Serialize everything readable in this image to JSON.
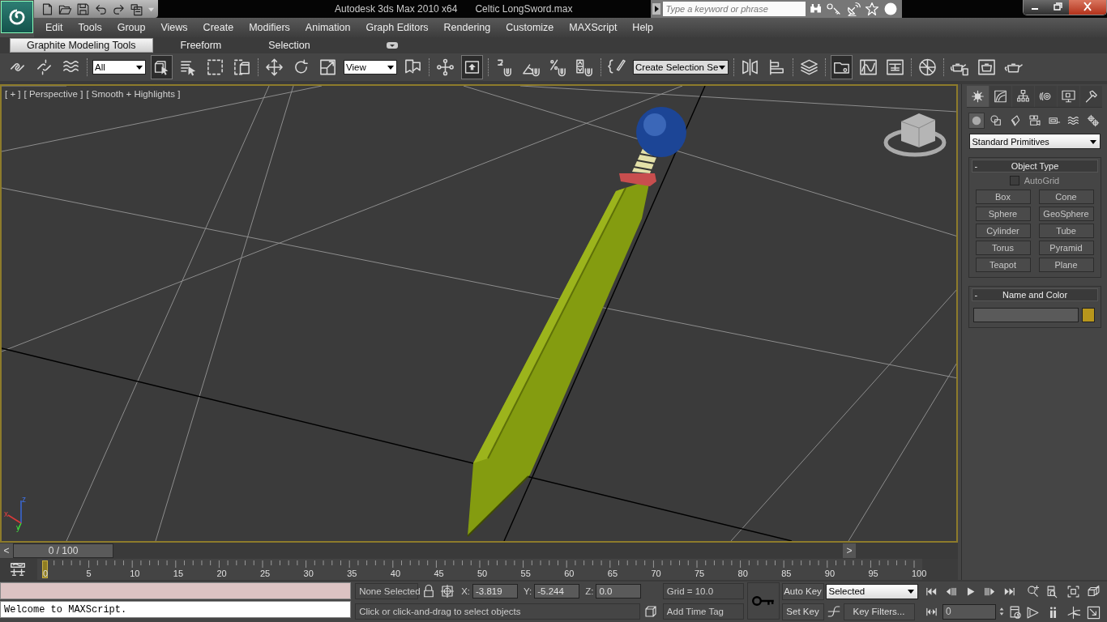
{
  "title_bar": {
    "app": "Autodesk 3ds Max  2010 x64",
    "file": "Celtic LongSword.max"
  },
  "search": {
    "placeholder": "Type a keyword or phrase"
  },
  "menu": [
    "Edit",
    "Tools",
    "Group",
    "Views",
    "Create",
    "Modifiers",
    "Animation",
    "Graph Editors",
    "Rendering",
    "Customize",
    "MAXScript",
    "Help"
  ],
  "ribbon_tabs": [
    {
      "label": "Graphite Modeling Tools",
      "selected": true
    },
    {
      "label": "Freeform",
      "selected": false
    },
    {
      "label": "Selection",
      "selected": false
    }
  ],
  "toolbar": [
    {
      "kind": "tool",
      "selected": false
    },
    {
      "kind": "tool",
      "selected": false
    },
    {
      "kind": "tool",
      "selected": false
    },
    {
      "kind": "separator"
    },
    {
      "kind": "dropdown",
      "value": "All"
    },
    {
      "kind": "tool",
      "selected": true
    },
    {
      "kind": "tool",
      "selected": false
    },
    {
      "kind": "tool",
      "selected": false
    },
    {
      "kind": "tool",
      "selected": false
    },
    {
      "kind": "separator"
    },
    {
      "kind": "tool",
      "selected": false
    },
    {
      "kind": "tool",
      "selected": false
    },
    {
      "kind": "tool",
      "selected": false
    },
    {
      "kind": "dropdown",
      "value": "View"
    },
    {
      "kind": "tool",
      "selected": false
    },
    {
      "kind": "separator"
    },
    {
      "kind": "tool",
      "selected": false
    },
    {
      "kind": "tool",
      "selected": true
    },
    {
      "kind": "separator"
    },
    {
      "kind": "tool",
      "selected": false
    },
    {
      "kind": "tool",
      "selected": false
    },
    {
      "kind": "tool",
      "selected": false
    },
    {
      "kind": "tool",
      "selected": false
    },
    {
      "kind": "separator"
    },
    {
      "kind": "tool",
      "selected": false
    },
    {
      "kind": "dropdown",
      "value": "Create Selection Se"
    },
    {
      "kind": "separator"
    },
    {
      "kind": "tool",
      "selected": false
    },
    {
      "kind": "tool",
      "selected": false
    },
    {
      "kind": "separator"
    },
    {
      "kind": "tool",
      "selected": false
    },
    {
      "kind": "separator"
    },
    {
      "kind": "tool",
      "selected": true
    },
    {
      "kind": "tool",
      "selected": false
    },
    {
      "kind": "tool",
      "selected": false
    },
    {
      "kind": "separator"
    },
    {
      "kind": "tool",
      "selected": false
    },
    {
      "kind": "separator"
    },
    {
      "kind": "tool",
      "selected": false
    },
    {
      "kind": "tool",
      "selected": false
    },
    {
      "kind": "tool",
      "selected": false
    }
  ],
  "viewport": {
    "labels": [
      "[ + ]",
      "[ Perspective ]",
      "[ Smooth + Highlights ]"
    ],
    "active": true,
    "axes": [
      "x",
      "y",
      "z"
    ]
  },
  "command_panel": {
    "tabs": [
      {
        "selected": true
      },
      {
        "selected": false
      },
      {
        "selected": false
      },
      {
        "selected": false
      },
      {
        "selected": false
      },
      {
        "selected": false
      }
    ],
    "categories": [
      {
        "selected": true
      },
      {
        "selected": false
      },
      {
        "selected": false
      },
      {
        "selected": false
      },
      {
        "selected": false
      },
      {
        "selected": false
      },
      {
        "selected": false
      }
    ],
    "type_list": "Standard Primitives",
    "object_type": {
      "collapse": "-",
      "title": "Object Type",
      "autogrid": {
        "label": "AutoGrid",
        "checked": false
      },
      "buttons": [
        "Box",
        "Cone",
        "Sphere",
        "GeoSphere",
        "Cylinder",
        "Tube",
        "Torus",
        "Pyramid",
        "Teapot",
        "Plane"
      ]
    },
    "name_and_color": {
      "collapse": "-",
      "title": "Name and Color",
      "color": "#b8961c"
    }
  },
  "time_slider": {
    "prev": "<",
    "position": "0 / 100",
    "next": ">",
    "level": 0
  },
  "track_bar": {
    "ticks": [
      "0",
      "5",
      "10",
      "15",
      "20",
      "25",
      "30",
      "35",
      "40",
      "45",
      "50",
      "55",
      "60",
      "65",
      "70",
      "75",
      "80",
      "85",
      "90",
      "95",
      "100"
    ],
    "level": 0
  },
  "status": {
    "listener_output": "Welcome to MAXScript.",
    "selection": "None Selected",
    "coords": [
      {
        "axis": "X:",
        "value": "-3.819"
      },
      {
        "axis": "Y:",
        "value": "-5.244"
      },
      {
        "axis": "Z:",
        "value": "0.0"
      }
    ],
    "grid": "Grid = 10.0",
    "prompt": "Click or click-and-drag to select objects",
    "add_time_tag": "Add Time Tag",
    "auto_key": {
      "label": "Auto Key",
      "on": false
    },
    "set_key": "Set Key",
    "key_mode": "Selected",
    "key_filters": "Key Filters...",
    "frame": "0"
  }
}
